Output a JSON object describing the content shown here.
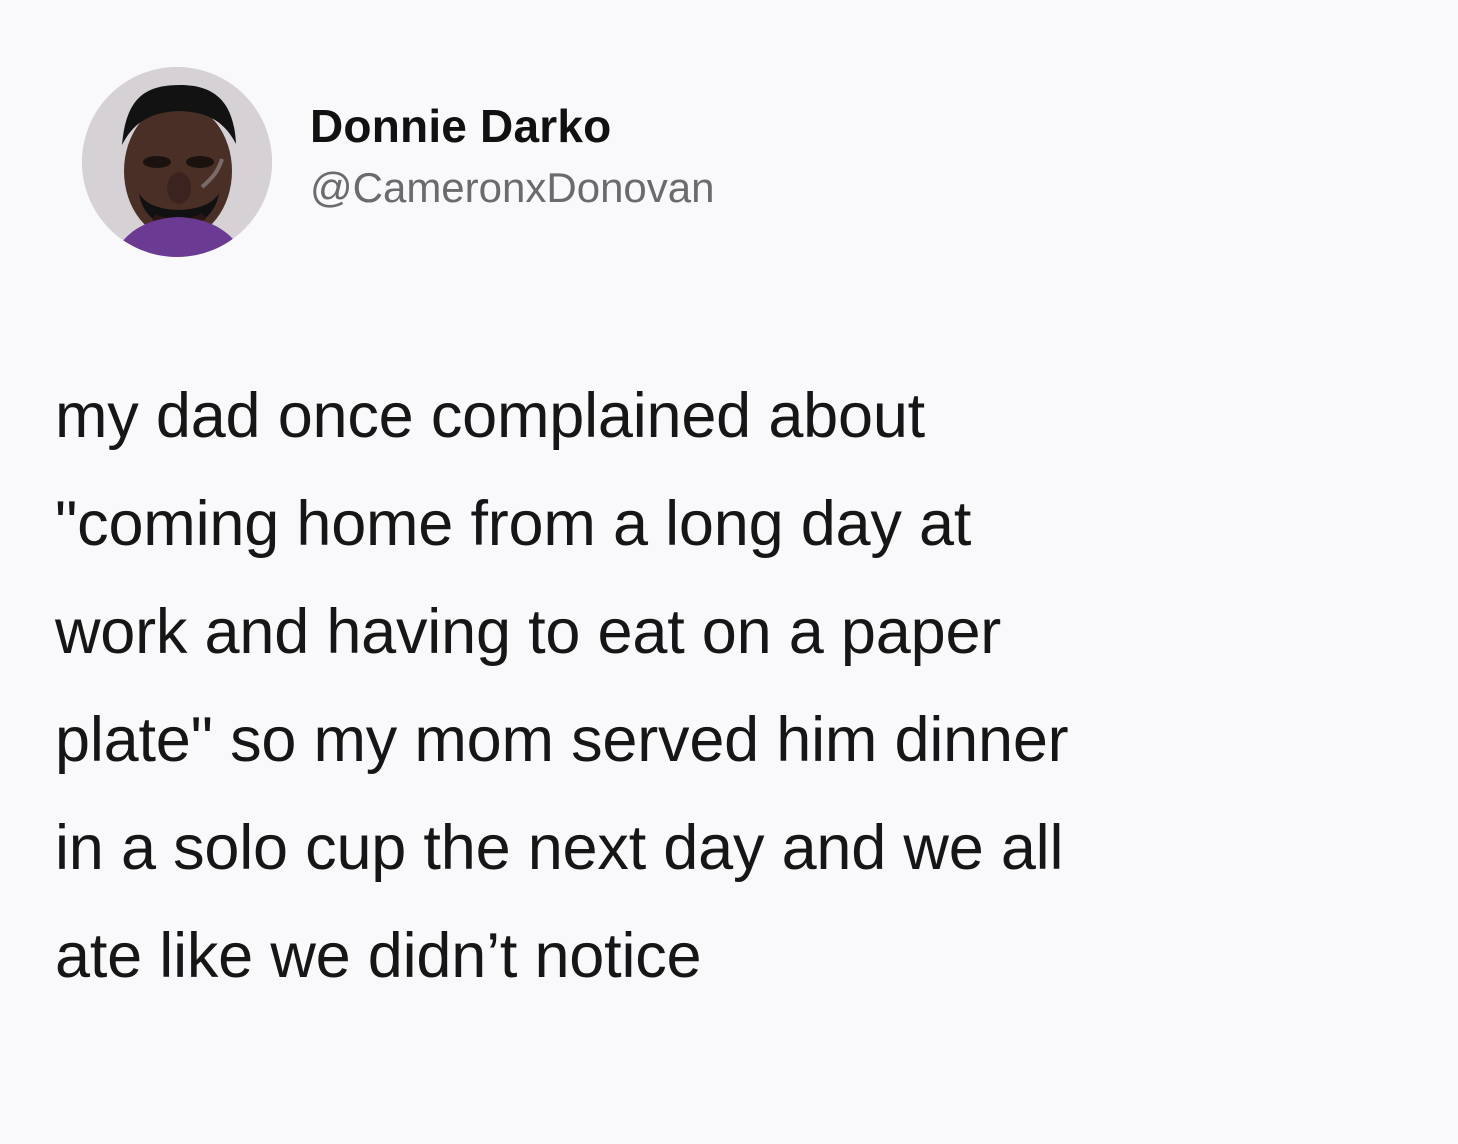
{
  "tweet": {
    "author": {
      "display_name": "Donnie Darko",
      "handle": "@CameronxDonovan",
      "avatar_icon": "profile-photo"
    },
    "text": "my dad once complained about\n\"coming home from a long day at\nwork  and having to eat on a paper\nplate\" so my mom served him dinner\nin a solo cup the next day and we all\nate like we didn’t notice"
  }
}
